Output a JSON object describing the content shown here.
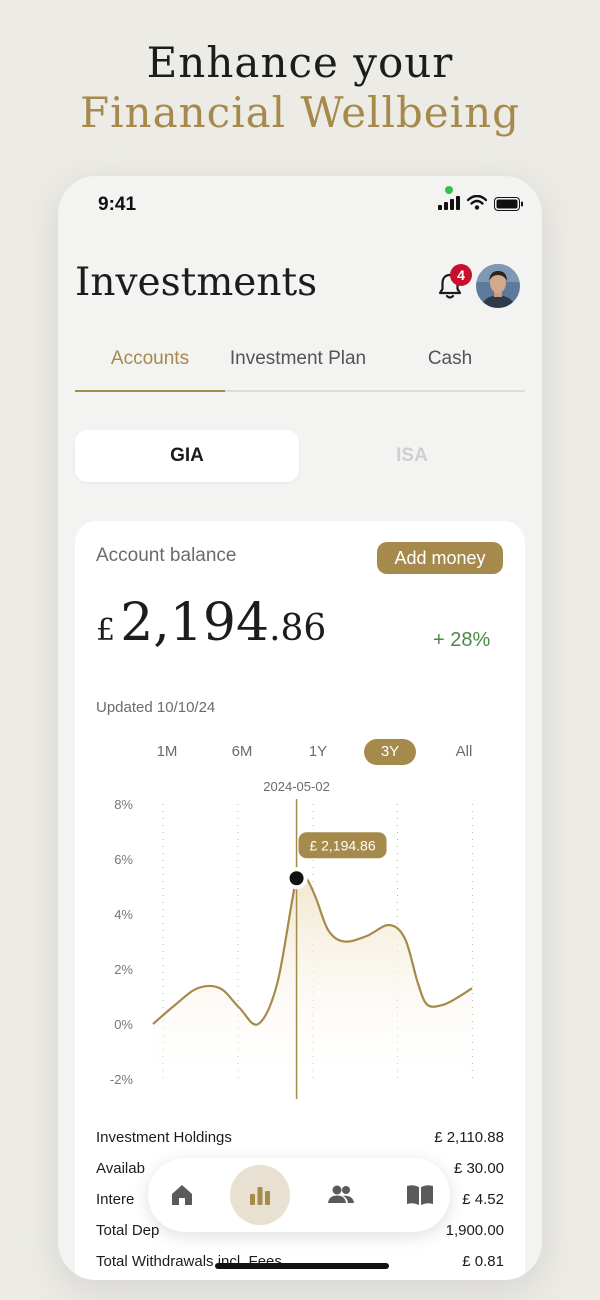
{
  "hero": {
    "line1": "Enhance your",
    "line2": "Financial Wellbeing"
  },
  "status_bar": {
    "time": "9:41"
  },
  "header": {
    "title": "Investments",
    "notification_count": "4"
  },
  "tabs": [
    {
      "label": "Accounts",
      "active": true
    },
    {
      "label": "Investment Plan",
      "active": false
    },
    {
      "label": "Cash",
      "active": false
    }
  ],
  "account_types": [
    {
      "label": "GIA",
      "active": true
    },
    {
      "label": "ISA",
      "active": false
    }
  ],
  "balance": {
    "label": "Account balance",
    "add_money": "Add money",
    "currency": "£",
    "whole": "2,194",
    "decimal": ".86",
    "change": "+ 28%",
    "updated": "Updated 10/10/24"
  },
  "periods": [
    {
      "label": "1M",
      "active": false
    },
    {
      "label": "6M",
      "active": false
    },
    {
      "label": "1Y",
      "active": false
    },
    {
      "label": "3Y",
      "active": true
    },
    {
      "label": "All",
      "active": false
    }
  ],
  "chart_data": {
    "type": "area",
    "y_ticks": [
      "8%",
      "6%",
      "4%",
      "2%",
      "0%",
      "-2%"
    ],
    "ylim": [
      -2,
      8
    ],
    "selected_date": "2024-05-02",
    "tooltip": "£ 2,194.86",
    "x": [
      0,
      0.07,
      0.14,
      0.21,
      0.27,
      0.33,
      0.39,
      0.45,
      0.48,
      0.51,
      0.55,
      0.6,
      0.67,
      0.74,
      0.79,
      0.83,
      0.86,
      0.91,
      0.96,
      1.0
    ],
    "values": [
      0.0,
      0.7,
      1.3,
      1.3,
      0.6,
      0.0,
      1.5,
      5.3,
      5.3,
      4.6,
      3.4,
      3.0,
      3.2,
      3.6,
      3.1,
      1.5,
      0.7,
      0.7,
      1.0,
      1.3
    ],
    "colors": {
      "line": "#a58a4c",
      "fill": "#f1e6cc"
    }
  },
  "summary": [
    {
      "label": "Investment Holdings",
      "value": "£ 2,110.88"
    },
    {
      "label": "Availab",
      "value": "£ 30.00"
    },
    {
      "label": "Intere",
      "value": "£ 4.52"
    },
    {
      "label": "Total Dep",
      "value": "1,900.00"
    },
    {
      "label": "Total Withdrawals incl. Fees",
      "value": "£ 0.81"
    }
  ],
  "nav": [
    {
      "icon": "home-icon",
      "active": false
    },
    {
      "icon": "chart-icon",
      "active": true
    },
    {
      "icon": "people-icon",
      "active": false
    },
    {
      "icon": "book-icon",
      "active": false
    }
  ],
  "colors": {
    "accent": "#a58a4c",
    "positive": "#4c8a45",
    "badge": "#c8102e"
  }
}
